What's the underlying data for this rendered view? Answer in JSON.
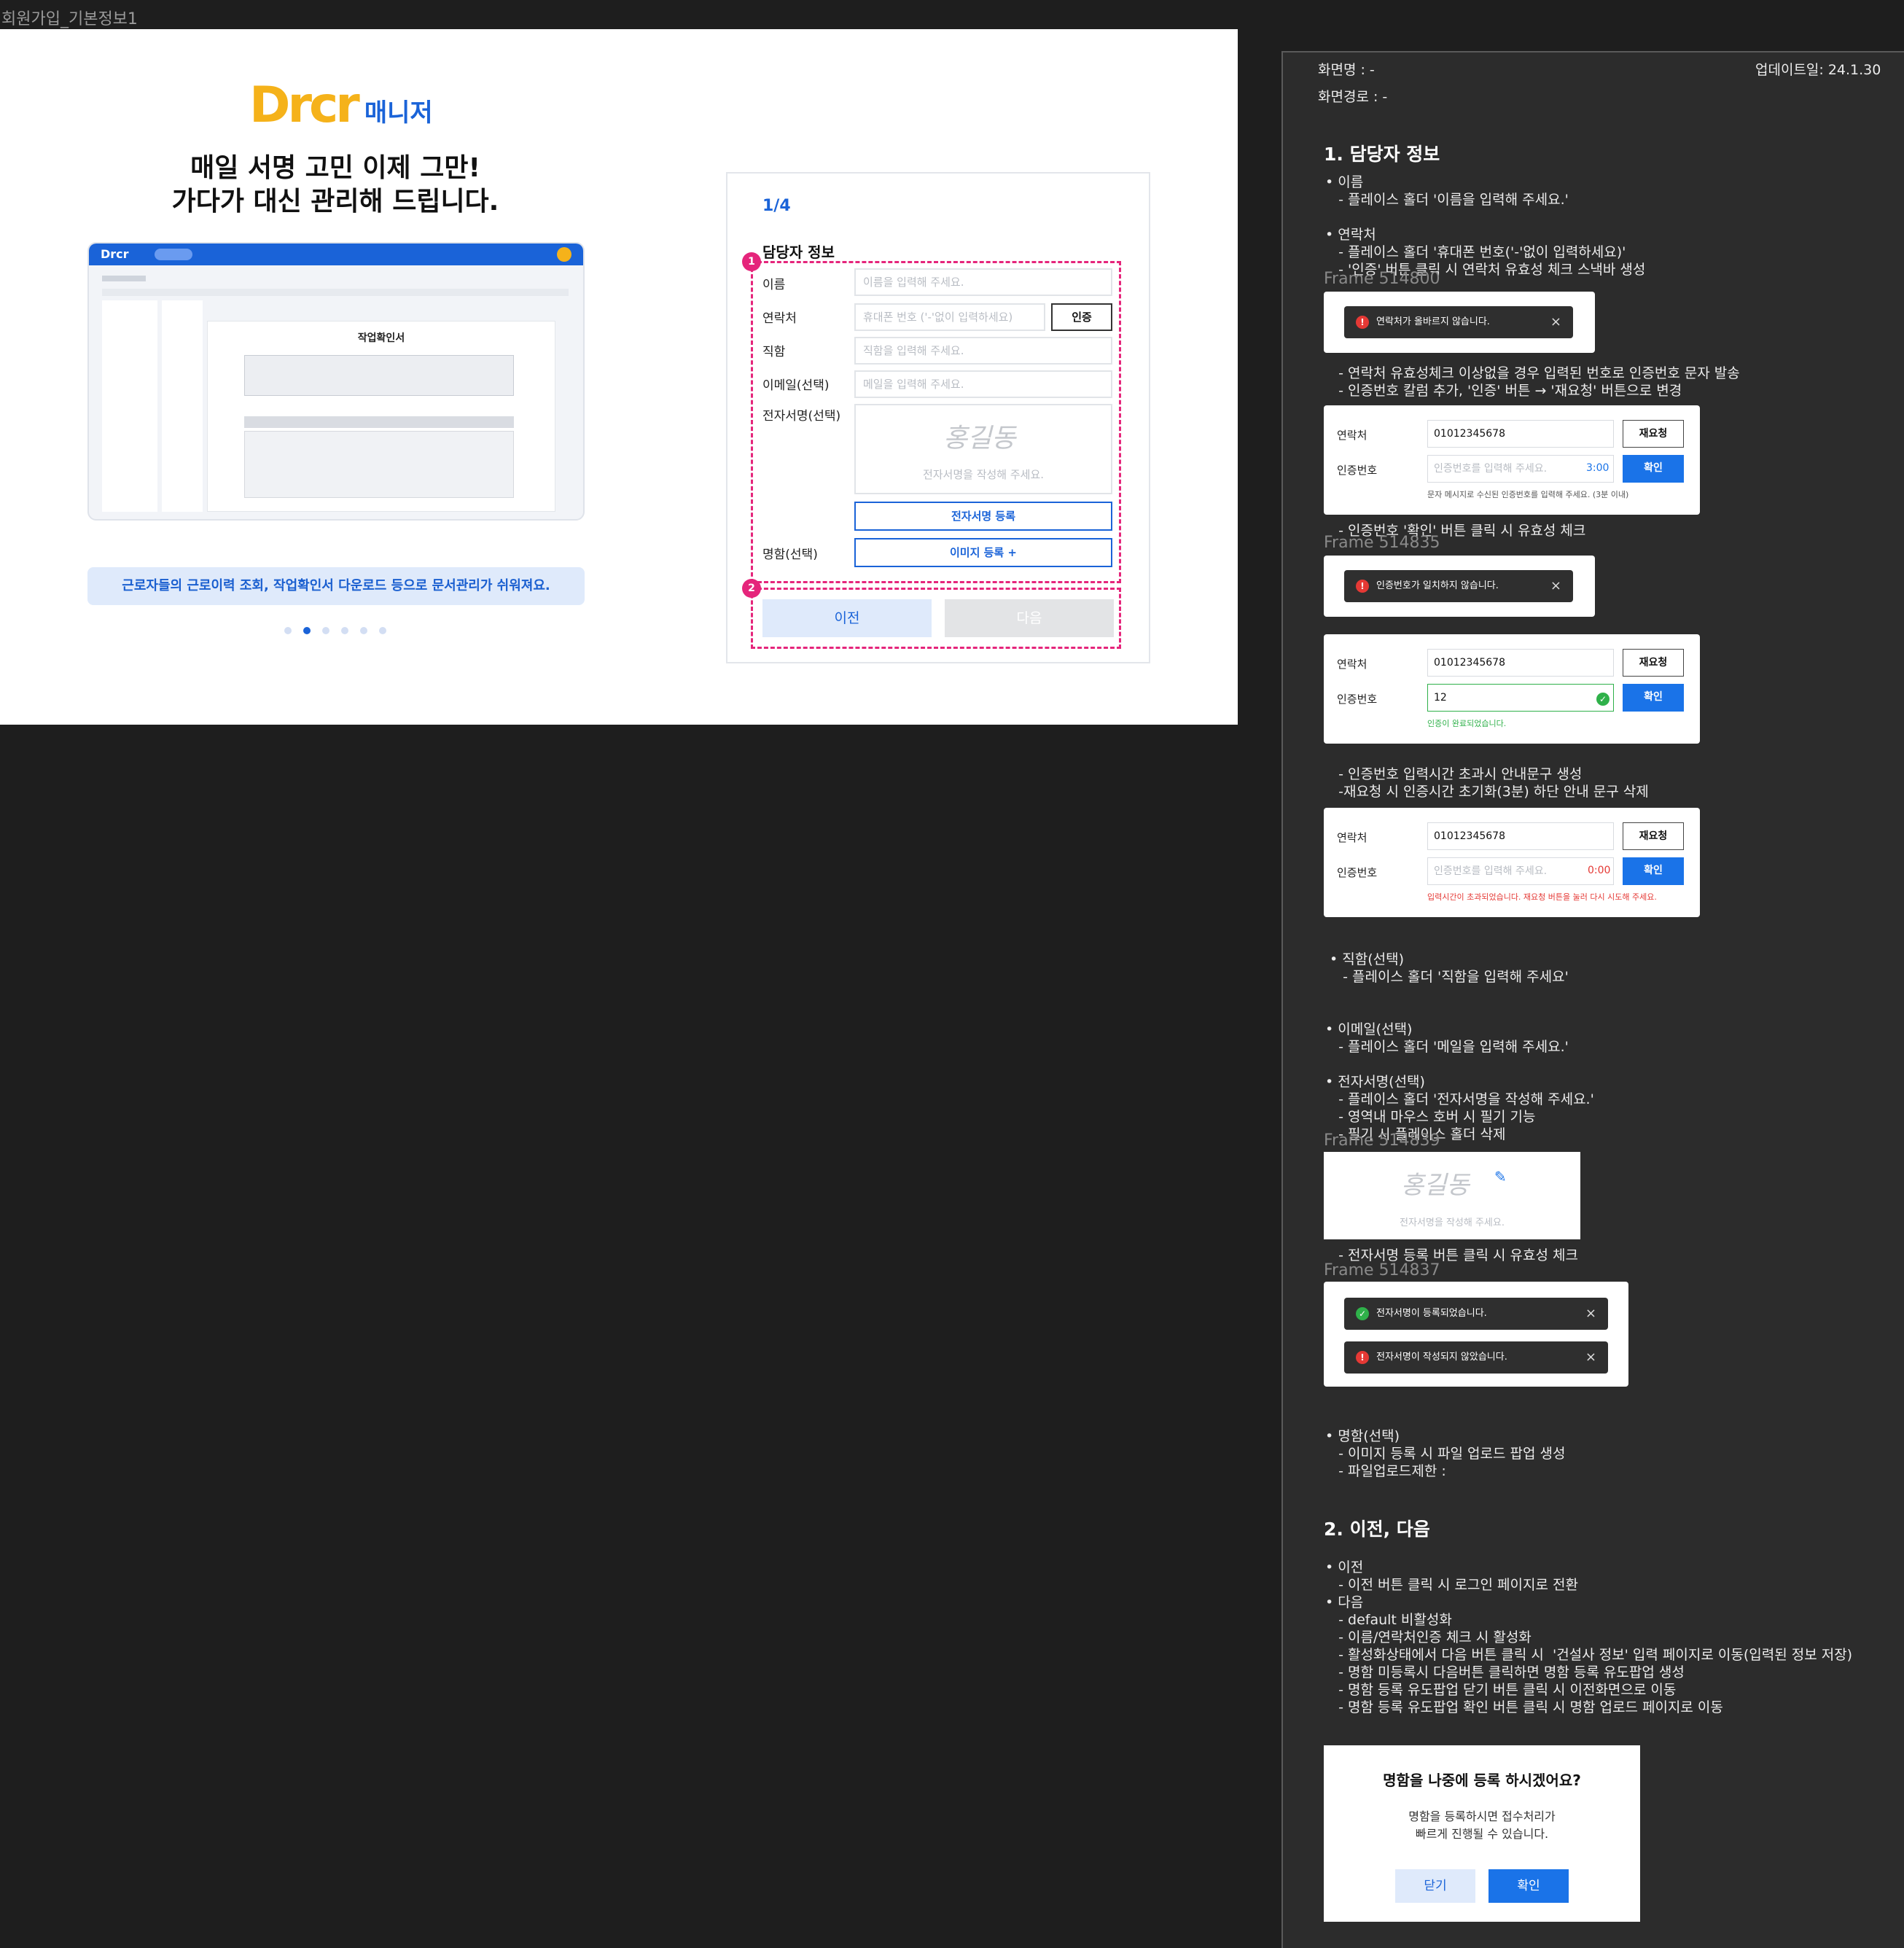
{
  "frame_title": "회원가입_기본정보1",
  "hero": {
    "logo_text": "Drcr",
    "logo_sub": "매니저",
    "headline_1": "매일 서명 고민 이제 그만!",
    "headline_2": "가다가 대신 관리해 드립니다.",
    "preview_title": "작업확인서",
    "banner": "근로자들의  근로이력 조회, 작업확인서 다운로드 등으로 문서관리가 쉬워져요.",
    "carousel_count": 6,
    "carousel_active": 2
  },
  "form": {
    "step": "1/4",
    "section_title": "담당자 정보",
    "badge1": "1",
    "badge2": "2",
    "name_label": "이름",
    "name_placeholder": "이름을 입력해 주세요.",
    "phone_label": "연락처",
    "phone_placeholder": "휴대폰 번호 ('-'없이 입력하세요)",
    "cert_button": "인증",
    "position_label": "직함",
    "position_placeholder": "직함을 입력해 주세요.",
    "email_label": "이메일(선택)",
    "email_placeholder": "메일을 입력해 주세요.",
    "sign_label": "전자서명(선택)",
    "sign_sample": "홍길동",
    "sign_placeholder": "전자서명을 작성해 주세요.",
    "sign_register": "전자서명 등록",
    "card_label": "명함(선택)",
    "card_register": "이미지 등록 +",
    "prev": "이전",
    "next": "다음"
  },
  "panel": {
    "screen_name": "화면명 : -",
    "updated": "업데이트일: 24.1.30",
    "screen_path": "화면경로 : -",
    "h1": "1. 담당자 정보",
    "t_name": "• 이름\n   - 플레이스 홀더 '이름을 입력해 주세요.'",
    "t_phone": "• 연락처\n   - 플레이스 홀더 '휴대폰 번호('-'없이 입력하세요)'\n   - '인증' 버튼 클릭 시 연락처 유효성 체크 스낵바 생성",
    "frame_800": "Frame 514800",
    "toast_phone_invalid": "연락처가 올바르지 않습니다.",
    "t_phone2": "   - 연락처 유효성체크 이상없을 경우 입력된 번호로 인증번호 문자 발송\n   - 인증번호 칼럼 추가, '인증' 버튼 → '재요청' 버튼으로 변경",
    "m_phone_label": "연락처",
    "m_phone_value": "01012345678",
    "m_resend": "재요청",
    "m_code_label": "인증번호",
    "m_code_placeholder": "인증번호를 입력해 주세요.",
    "m_timer": "3:00",
    "m_confirm": "확인",
    "m_hint": "문자 메시지로 수신된 인증번호를 입력해 주세요. (3분 이내)",
    "t_code": "   - 인증번호 '확인' 버튼 클릭 시 유효성 체크",
    "frame_835": "Frame 514835",
    "toast_code_mismatch": "인증번호가 일치하지 않습니다.",
    "m_code_value": "12",
    "m_done": "인증이 완료되었습니다.",
    "t_timeout": "   - 인증번호 입력시간 초과시 안내문구 생성\n   -재요청 시 인증시간 초기화(3분) 하단 안내 문구 삭제",
    "m_timer_zero": "0:00",
    "m_timeout": "입력시간이 초과되었습니다. 재요청 버튼을 눌러 다시 시도해 주세요.",
    "t_position": "• 직함(선택)\n   - 플레이스 홀더 '직함을 입력해 주세요'",
    "t_email": "• 이메일(선택)\n   - 플레이스 홀더 '메일을 입력해 주세요.'",
    "t_sign": "• 전자서명(선택)\n   - 플레이스 홀더 '전자서명을 작성해 주세요.'\n   - 영역내 마우스 호버 시 필기 기능\n   - 필기 시 플레이스 홀더 삭제",
    "frame_839": "Frame 514839",
    "sign_sample": "홍길동",
    "sign_placeholder": "전자서명을 작성해 주세요.",
    "t_sign2": "   - 전자서명 등록 버튼 클릭 시 유효성 체크",
    "frame_837": "Frame 514837",
    "toast_sign_ok": "전자서명이 등록되었습니다.",
    "toast_sign_missing": "전자서명이 작성되지 않았습니다.",
    "t_card": "• 명함(선택)\n   - 이미지 등록 시 파일 업로드 팝업 생성\n   - 파일업로드제한 :",
    "h2": "2. 이전, 다음",
    "t_nav": "• 이전\n   - 이전 버튼 클릭 시 로그인 페이지로 전환\n• 다음\n   - default 비활성화\n   - 이름/연락처인증 체크 시 활성화\n   - 활성화상태에서 다음 버튼 클릭 시  '건설사 정보' 입력 페이지로 이동(입력된 정보 저장)\n   - 명함 미등록시 다음버튼 클릭하면 명함 등록 유도팝업 생성\n   - 명함 등록 유도팝업 닫기 버튼 클릭 시 이전화면으로 이동\n   - 명함 등록 유도팝업 확인 버튼 클릭 시 명함 업로드 페이지로 이동",
    "modal_title": "명함을 나중에 등록 하시겠어요?",
    "modal_body_1": "명함을 등록하시면 접수처리가",
    "modal_body_2": "빠르게 진행될 수 있습니다.",
    "modal_close": "닫기",
    "modal_ok": "확인"
  },
  "colors": {
    "brand_blue": "#1a63d8",
    "brand_yellow": "#f5b21a",
    "annotation_pink": "#e5257b",
    "error_red": "#e53935",
    "success_green": "#2fb14a"
  }
}
